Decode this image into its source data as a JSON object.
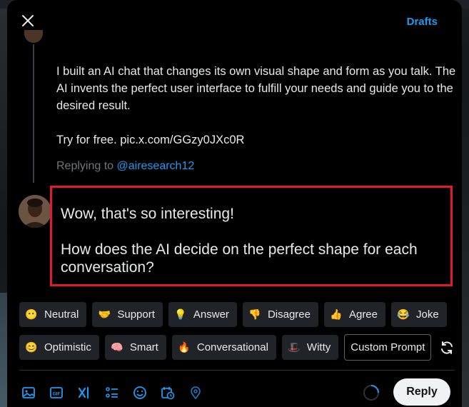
{
  "topbar": {
    "drafts_label": "Drafts"
  },
  "tweet": {
    "lines_a": "I built an AI chat that changes its own visual shape and form as you talk. The AI invents the perfect user interface to fulfill your needs and guide you to the desired result.",
    "lines_b": "Try for free. pic.x.com/GGzy0JXc0R"
  },
  "replying": {
    "prefix": "Replying to ",
    "handle": "@airesearch12"
  },
  "reply": {
    "line1": "Wow, that's so interesting!",
    "line2": "How does the AI decide on the perfect shape for each conversation?"
  },
  "chips_row1": [
    {
      "label": "Neutral",
      "emoji": "😶"
    },
    {
      "label": "Support",
      "emoji": "🤝"
    },
    {
      "label": "Answer",
      "emoji": "💡"
    },
    {
      "label": "Disagree",
      "emoji": "👎"
    },
    {
      "label": "Agree",
      "emoji": "👍"
    },
    {
      "label": "Joke",
      "emoji": "😂"
    }
  ],
  "chips_row2": [
    {
      "label": "Optimistic",
      "emoji": "😊"
    },
    {
      "label": "Smart",
      "emoji": "🧠"
    },
    {
      "label": "Conversational",
      "emoji": "🔥"
    },
    {
      "label": "Witty",
      "emoji": "🎩"
    }
  ],
  "custom_prompt_label": "Custom Prompt",
  "reply_button_label": "Reply",
  "icons": [
    "image-icon",
    "gif-icon",
    "grok-icon",
    "poll-icon",
    "emoji-icon",
    "schedule-icon",
    "location-icon"
  ],
  "colors": {
    "accent": "#1d9bf0",
    "highlight_border": "#e11b2b",
    "chip_bg": "#202327"
  }
}
